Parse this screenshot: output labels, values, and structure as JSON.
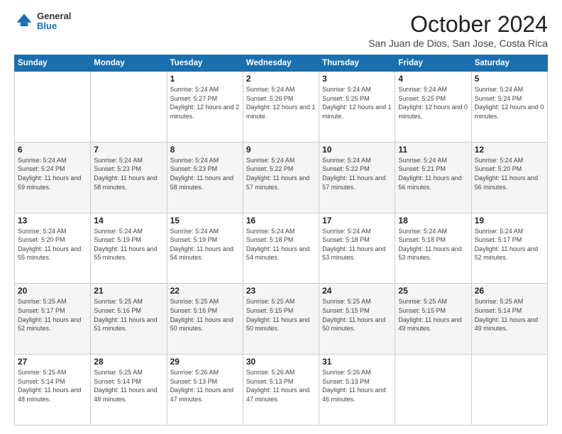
{
  "logo": {
    "general": "General",
    "blue": "Blue"
  },
  "title": "October 2024",
  "location": "San Juan de Dios, San Jose, Costa Rica",
  "days_of_week": [
    "Sunday",
    "Monday",
    "Tuesday",
    "Wednesday",
    "Thursday",
    "Friday",
    "Saturday"
  ],
  "weeks": [
    [
      {
        "day": null,
        "sunrise": null,
        "sunset": null,
        "daylight": null
      },
      {
        "day": null,
        "sunrise": null,
        "sunset": null,
        "daylight": null
      },
      {
        "day": "1",
        "sunrise": "Sunrise: 5:24 AM",
        "sunset": "Sunset: 5:27 PM",
        "daylight": "Daylight: 12 hours and 2 minutes."
      },
      {
        "day": "2",
        "sunrise": "Sunrise: 5:24 AM",
        "sunset": "Sunset: 5:26 PM",
        "daylight": "Daylight: 12 hours and 1 minute."
      },
      {
        "day": "3",
        "sunrise": "Sunrise: 5:24 AM",
        "sunset": "Sunset: 5:25 PM",
        "daylight": "Daylight: 12 hours and 1 minute."
      },
      {
        "day": "4",
        "sunrise": "Sunrise: 5:24 AM",
        "sunset": "Sunset: 5:25 PM",
        "daylight": "Daylight: 12 hours and 0 minutes."
      },
      {
        "day": "5",
        "sunrise": "Sunrise: 5:24 AM",
        "sunset": "Sunset: 5:24 PM",
        "daylight": "Daylight: 12 hours and 0 minutes."
      }
    ],
    [
      {
        "day": "6",
        "sunrise": "Sunrise: 5:24 AM",
        "sunset": "Sunset: 5:24 PM",
        "daylight": "Daylight: 11 hours and 59 minutes."
      },
      {
        "day": "7",
        "sunrise": "Sunrise: 5:24 AM",
        "sunset": "Sunset: 5:23 PM",
        "daylight": "Daylight: 11 hours and 58 minutes."
      },
      {
        "day": "8",
        "sunrise": "Sunrise: 5:24 AM",
        "sunset": "Sunset: 5:23 PM",
        "daylight": "Daylight: 11 hours and 58 minutes."
      },
      {
        "day": "9",
        "sunrise": "Sunrise: 5:24 AM",
        "sunset": "Sunset: 5:22 PM",
        "daylight": "Daylight: 11 hours and 57 minutes."
      },
      {
        "day": "10",
        "sunrise": "Sunrise: 5:24 AM",
        "sunset": "Sunset: 5:22 PM",
        "daylight": "Daylight: 11 hours and 57 minutes."
      },
      {
        "day": "11",
        "sunrise": "Sunrise: 5:24 AM",
        "sunset": "Sunset: 5:21 PM",
        "daylight": "Daylight: 11 hours and 56 minutes."
      },
      {
        "day": "12",
        "sunrise": "Sunrise: 5:24 AM",
        "sunset": "Sunset: 5:20 PM",
        "daylight": "Daylight: 11 hours and 56 minutes."
      }
    ],
    [
      {
        "day": "13",
        "sunrise": "Sunrise: 5:24 AM",
        "sunset": "Sunset: 5:20 PM",
        "daylight": "Daylight: 11 hours and 55 minutes."
      },
      {
        "day": "14",
        "sunrise": "Sunrise: 5:24 AM",
        "sunset": "Sunset: 5:19 PM",
        "daylight": "Daylight: 11 hours and 55 minutes."
      },
      {
        "day": "15",
        "sunrise": "Sunrise: 5:24 AM",
        "sunset": "Sunset: 5:19 PM",
        "daylight": "Daylight: 11 hours and 54 minutes."
      },
      {
        "day": "16",
        "sunrise": "Sunrise: 5:24 AM",
        "sunset": "Sunset: 5:18 PM",
        "daylight": "Daylight: 11 hours and 54 minutes."
      },
      {
        "day": "17",
        "sunrise": "Sunrise: 5:24 AM",
        "sunset": "Sunset: 5:18 PM",
        "daylight": "Daylight: 11 hours and 53 minutes."
      },
      {
        "day": "18",
        "sunrise": "Sunrise: 5:24 AM",
        "sunset": "Sunset: 5:18 PM",
        "daylight": "Daylight: 11 hours and 53 minutes."
      },
      {
        "day": "19",
        "sunrise": "Sunrise: 5:24 AM",
        "sunset": "Sunset: 5:17 PM",
        "daylight": "Daylight: 11 hours and 52 minutes."
      }
    ],
    [
      {
        "day": "20",
        "sunrise": "Sunrise: 5:25 AM",
        "sunset": "Sunset: 5:17 PM",
        "daylight": "Daylight: 11 hours and 52 minutes."
      },
      {
        "day": "21",
        "sunrise": "Sunrise: 5:25 AM",
        "sunset": "Sunset: 5:16 PM",
        "daylight": "Daylight: 11 hours and 51 minutes."
      },
      {
        "day": "22",
        "sunrise": "Sunrise: 5:25 AM",
        "sunset": "Sunset: 5:16 PM",
        "daylight": "Daylight: 11 hours and 50 minutes."
      },
      {
        "day": "23",
        "sunrise": "Sunrise: 5:25 AM",
        "sunset": "Sunset: 5:15 PM",
        "daylight": "Daylight: 11 hours and 50 minutes."
      },
      {
        "day": "24",
        "sunrise": "Sunrise: 5:25 AM",
        "sunset": "Sunset: 5:15 PM",
        "daylight": "Daylight: 11 hours and 50 minutes."
      },
      {
        "day": "25",
        "sunrise": "Sunrise: 5:25 AM",
        "sunset": "Sunset: 5:15 PM",
        "daylight": "Daylight: 11 hours and 49 minutes."
      },
      {
        "day": "26",
        "sunrise": "Sunrise: 5:25 AM",
        "sunset": "Sunset: 5:14 PM",
        "daylight": "Daylight: 11 hours and 49 minutes."
      }
    ],
    [
      {
        "day": "27",
        "sunrise": "Sunrise: 5:25 AM",
        "sunset": "Sunset: 5:14 PM",
        "daylight": "Daylight: 11 hours and 48 minutes."
      },
      {
        "day": "28",
        "sunrise": "Sunrise: 5:25 AM",
        "sunset": "Sunset: 5:14 PM",
        "daylight": "Daylight: 11 hours and 48 minutes."
      },
      {
        "day": "29",
        "sunrise": "Sunrise: 5:26 AM",
        "sunset": "Sunset: 5:13 PM",
        "daylight": "Daylight: 11 hours and 47 minutes."
      },
      {
        "day": "30",
        "sunrise": "Sunrise: 5:26 AM",
        "sunset": "Sunset: 5:13 PM",
        "daylight": "Daylight: 11 hours and 47 minutes."
      },
      {
        "day": "31",
        "sunrise": "Sunrise: 5:26 AM",
        "sunset": "Sunset: 5:13 PM",
        "daylight": "Daylight: 11 hours and 46 minutes."
      },
      {
        "day": null,
        "sunrise": null,
        "sunset": null,
        "daylight": null
      },
      {
        "day": null,
        "sunrise": null,
        "sunset": null,
        "daylight": null
      }
    ]
  ]
}
